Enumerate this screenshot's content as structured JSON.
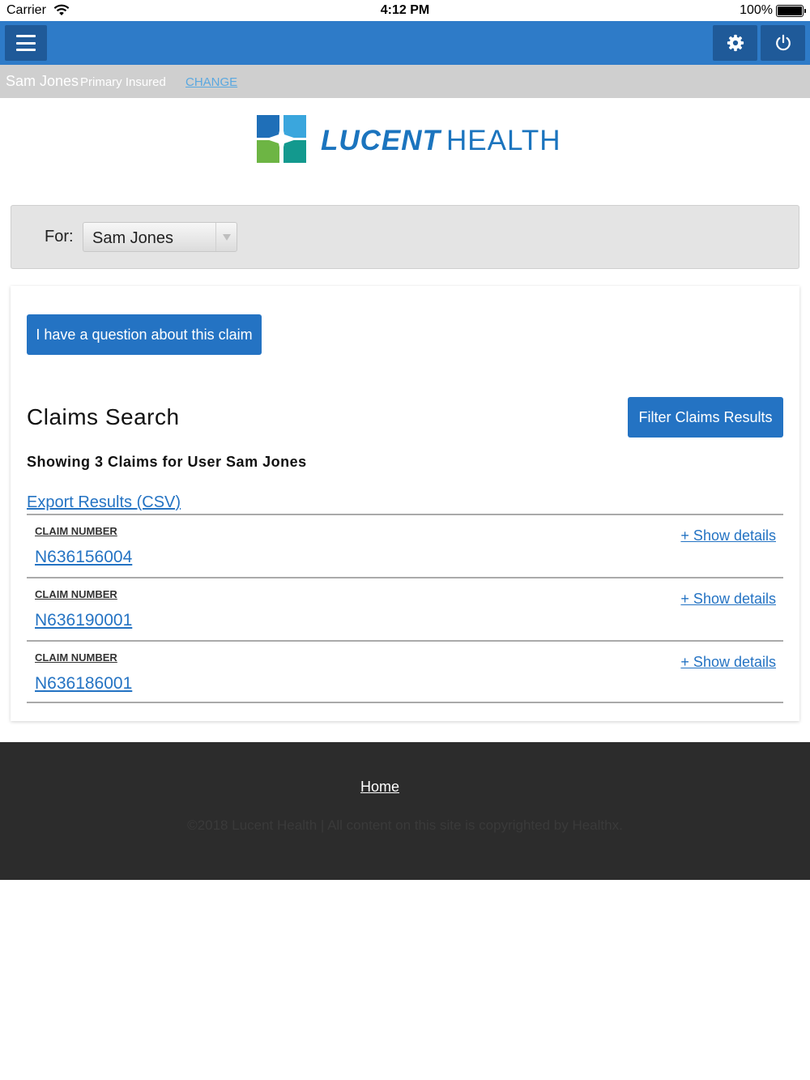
{
  "status_bar": {
    "carrier": "Carrier",
    "time": "4:12 PM",
    "battery": "100%"
  },
  "header": {
    "menu_icon": "hamburger-menu-icon",
    "settings_icon": "gear-icon",
    "power_icon": "power-icon",
    "color": "#2e7bc8"
  },
  "member_bar": {
    "name": "Sam Jones",
    "role": "Primary Insured",
    "change_label": "CHANGE"
  },
  "logo": {
    "bold": "LUCENT",
    "light": "HEALTH"
  },
  "for_panel": {
    "label": "For:",
    "selected": "Sam Jones"
  },
  "main": {
    "question_button": "I have a question about this claim",
    "title": "Claims Search",
    "filter_button": "Filter Claims Results",
    "showing_text": "Showing 3 Claims for User Sam Jones",
    "export_link": "Export Results (CSV)",
    "claims": [
      {
        "label": "CLAIM NUMBER",
        "number": "N636156004",
        "show_details": "+ Show details"
      },
      {
        "label": "CLAIM NUMBER",
        "number": "N636190001",
        "show_details": "+ Show details"
      },
      {
        "label": "CLAIM NUMBER",
        "number": "N636186001",
        "show_details": "+ Show details"
      }
    ]
  },
  "footer": {
    "home_link": "Home",
    "copyright": "©2018 Lucent Health | All content on this site is copyrighted by Healthx."
  }
}
